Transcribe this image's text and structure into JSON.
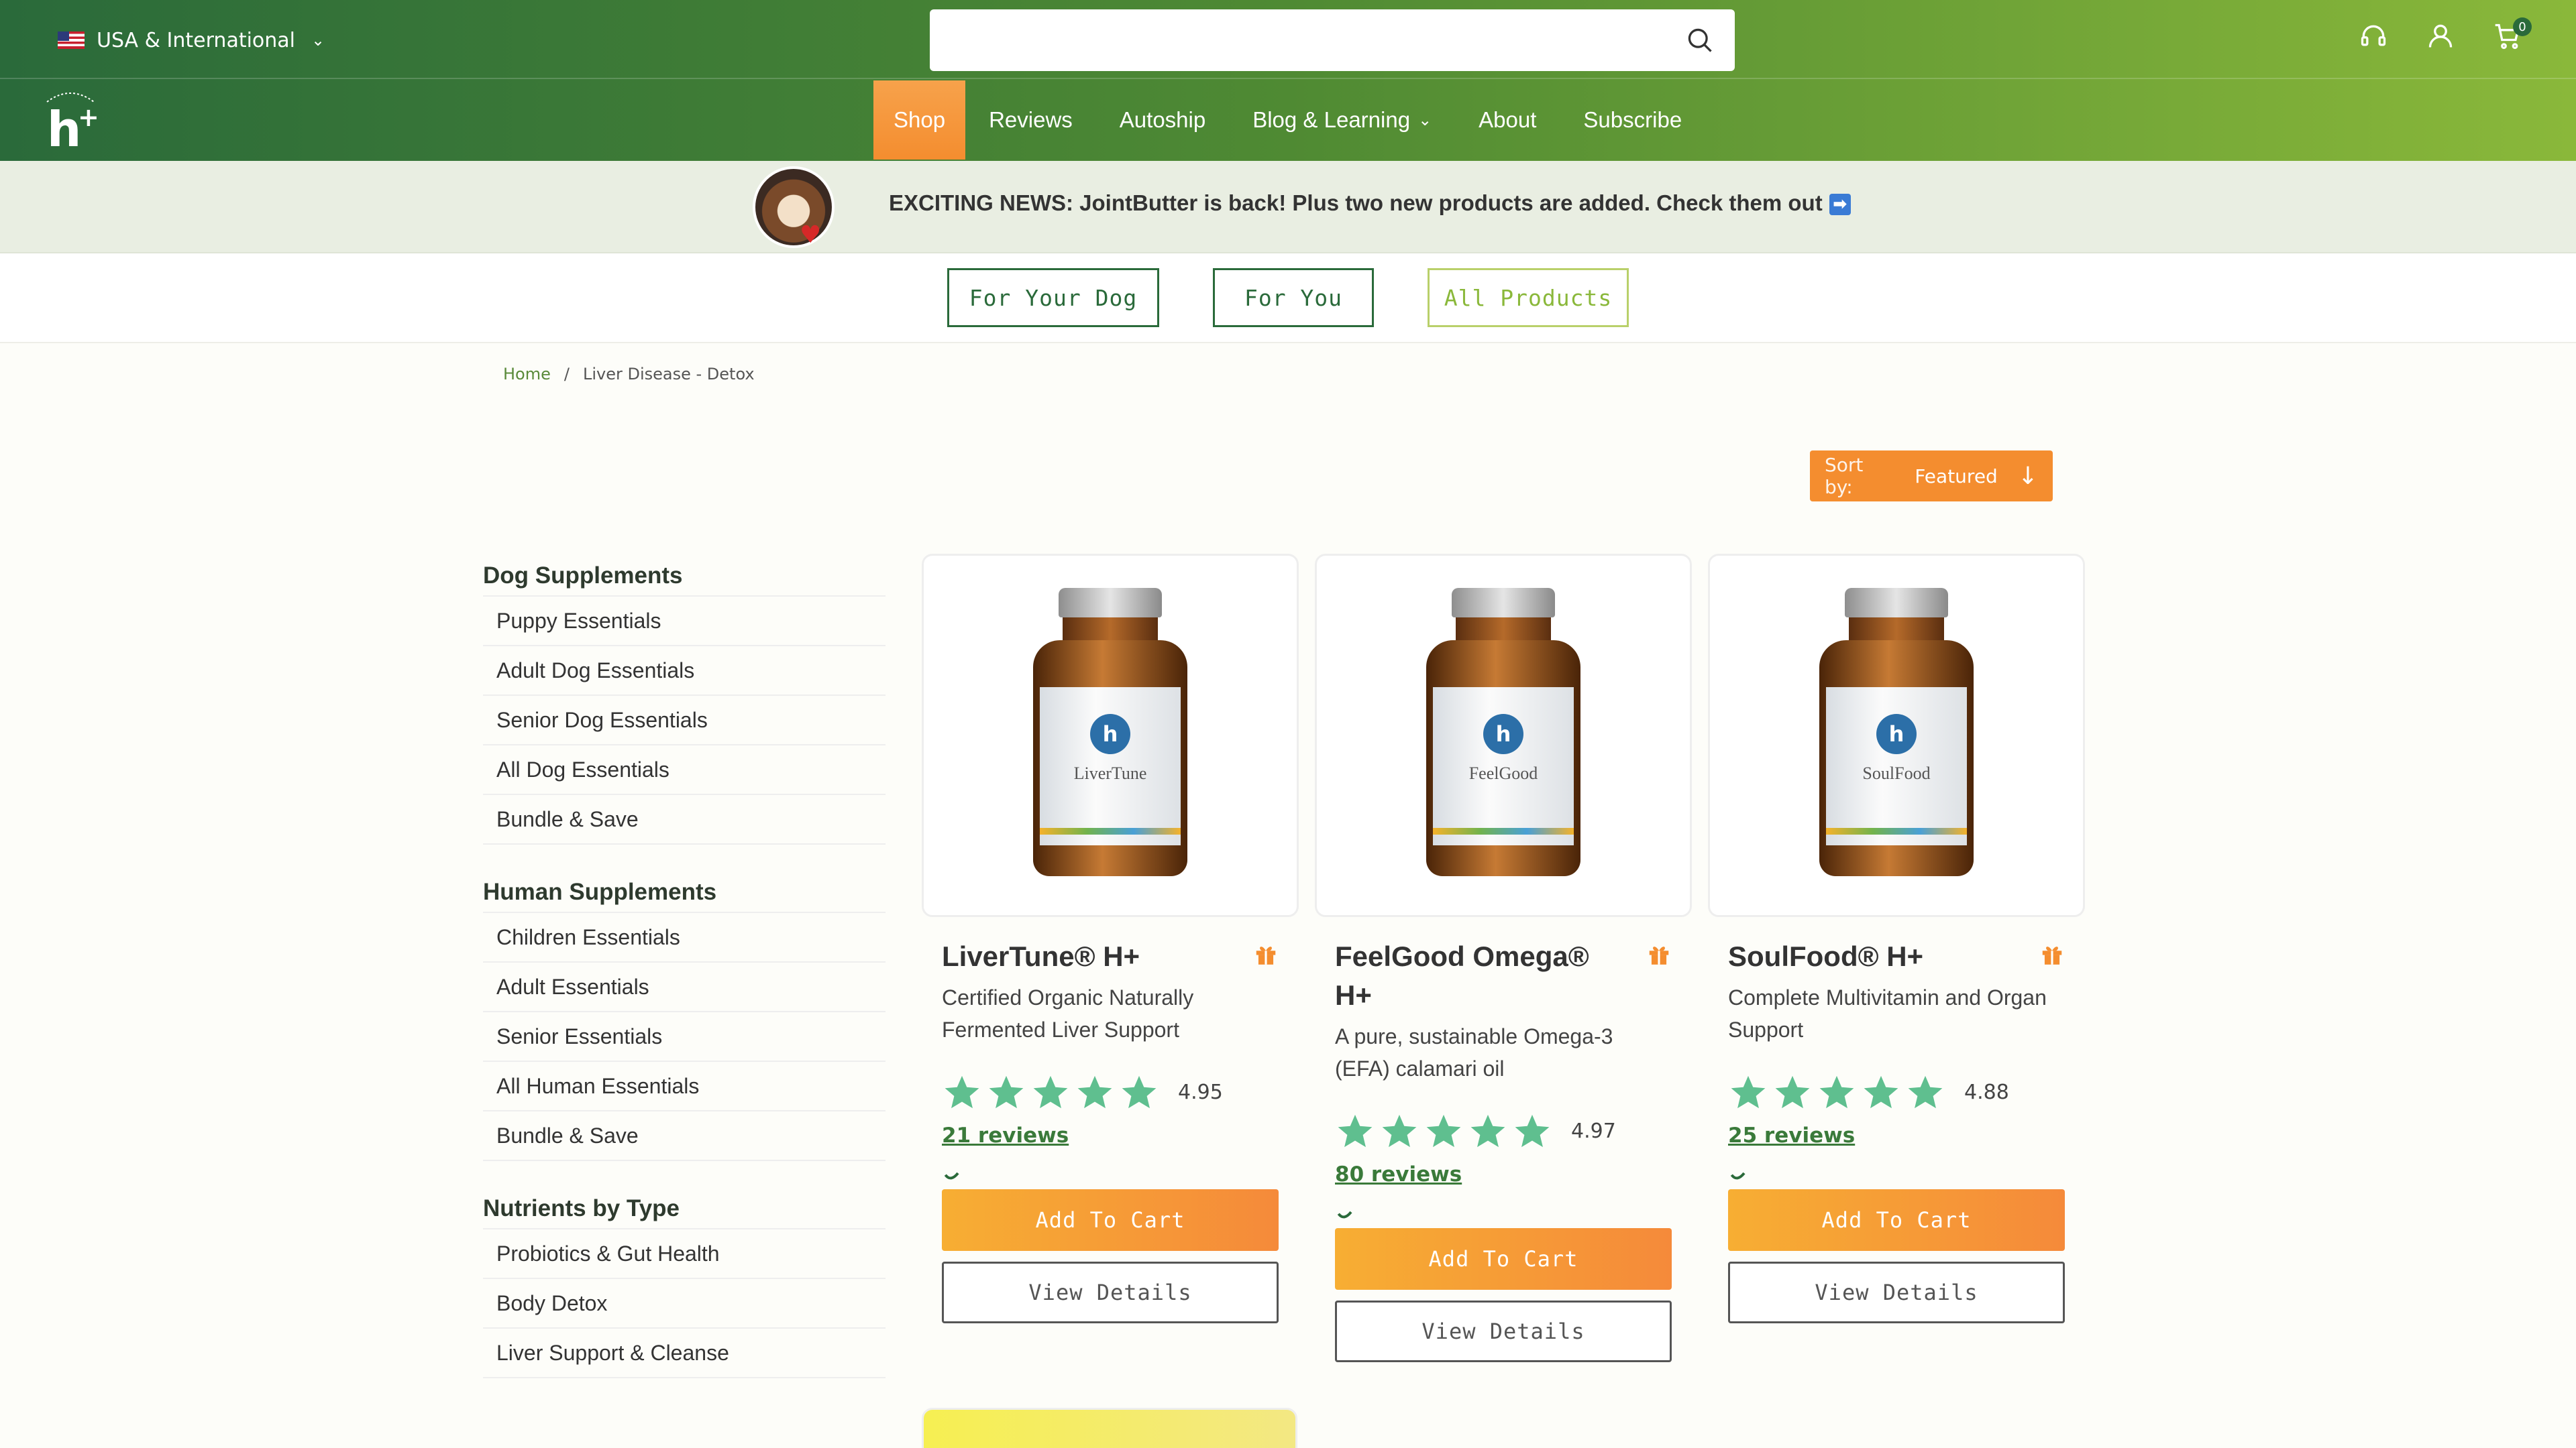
{
  "header": {
    "region_label": "USA & International",
    "search_placeholder": "",
    "cart_count": "0",
    "nav": [
      {
        "label": "Shop",
        "active": true
      },
      {
        "label": "Reviews"
      },
      {
        "label": "Autoship"
      },
      {
        "label": "Blog & Learning",
        "dropdown": true
      },
      {
        "label": "About"
      },
      {
        "label": "Subscribe"
      }
    ]
  },
  "announcement": {
    "text": "EXCITING NEWS: JointButter is back! Plus two new products are added. Check them out"
  },
  "filters": [
    {
      "label": "For Your Dog"
    },
    {
      "label": "For You"
    },
    {
      "label": "All Products"
    }
  ],
  "breadcrumb": {
    "home": "Home",
    "separator": "/",
    "current": "Liver Disease - Detox"
  },
  "sort": {
    "label": "Sort by:",
    "value": "Featured"
  },
  "sidebar": [
    {
      "title": "Dog Supplements",
      "items": [
        "Puppy Essentials",
        "Adult Dog Essentials",
        "Senior Dog Essentials",
        "All Dog Essentials",
        "Bundle & Save"
      ]
    },
    {
      "title": "Human Supplements",
      "items": [
        "Children Essentials",
        "Adult Essentials",
        "Senior Essentials",
        "All Human Essentials",
        "Bundle & Save"
      ]
    },
    {
      "title": "Nutrients by Type",
      "items": [
        "Probiotics & Gut Health",
        "Body Detox",
        "Liver Support & Cleanse"
      ]
    }
  ],
  "products": [
    {
      "name": "LiverTune® H+",
      "jar_name": "LiverTune",
      "description": "Certified Organic Naturally Fermented Liver Support",
      "rating": "4.95",
      "reviews": "21 reviews",
      "add_label": "Add To Cart",
      "view_label": "View Details"
    },
    {
      "name": "FeelGood Omega® H+",
      "jar_name": "FeelGood",
      "description": "A pure, sustainable Omega-3 (EFA) calamari oil",
      "rating": "4.97",
      "reviews": "80 reviews",
      "add_label": "Add To Cart",
      "view_label": "View Details"
    },
    {
      "name": "SoulFood® H+",
      "jar_name": "SoulFood",
      "description": "Complete Multivitamin and Organ Support",
      "rating": "4.88",
      "reviews": "25 reviews",
      "add_label": "Add To Cart",
      "view_label": "View Details"
    }
  ],
  "colors": {
    "brand_green": "#2a6a3a",
    "accent_orange": "#f48d2f",
    "star_green": "#5fbf8f"
  }
}
